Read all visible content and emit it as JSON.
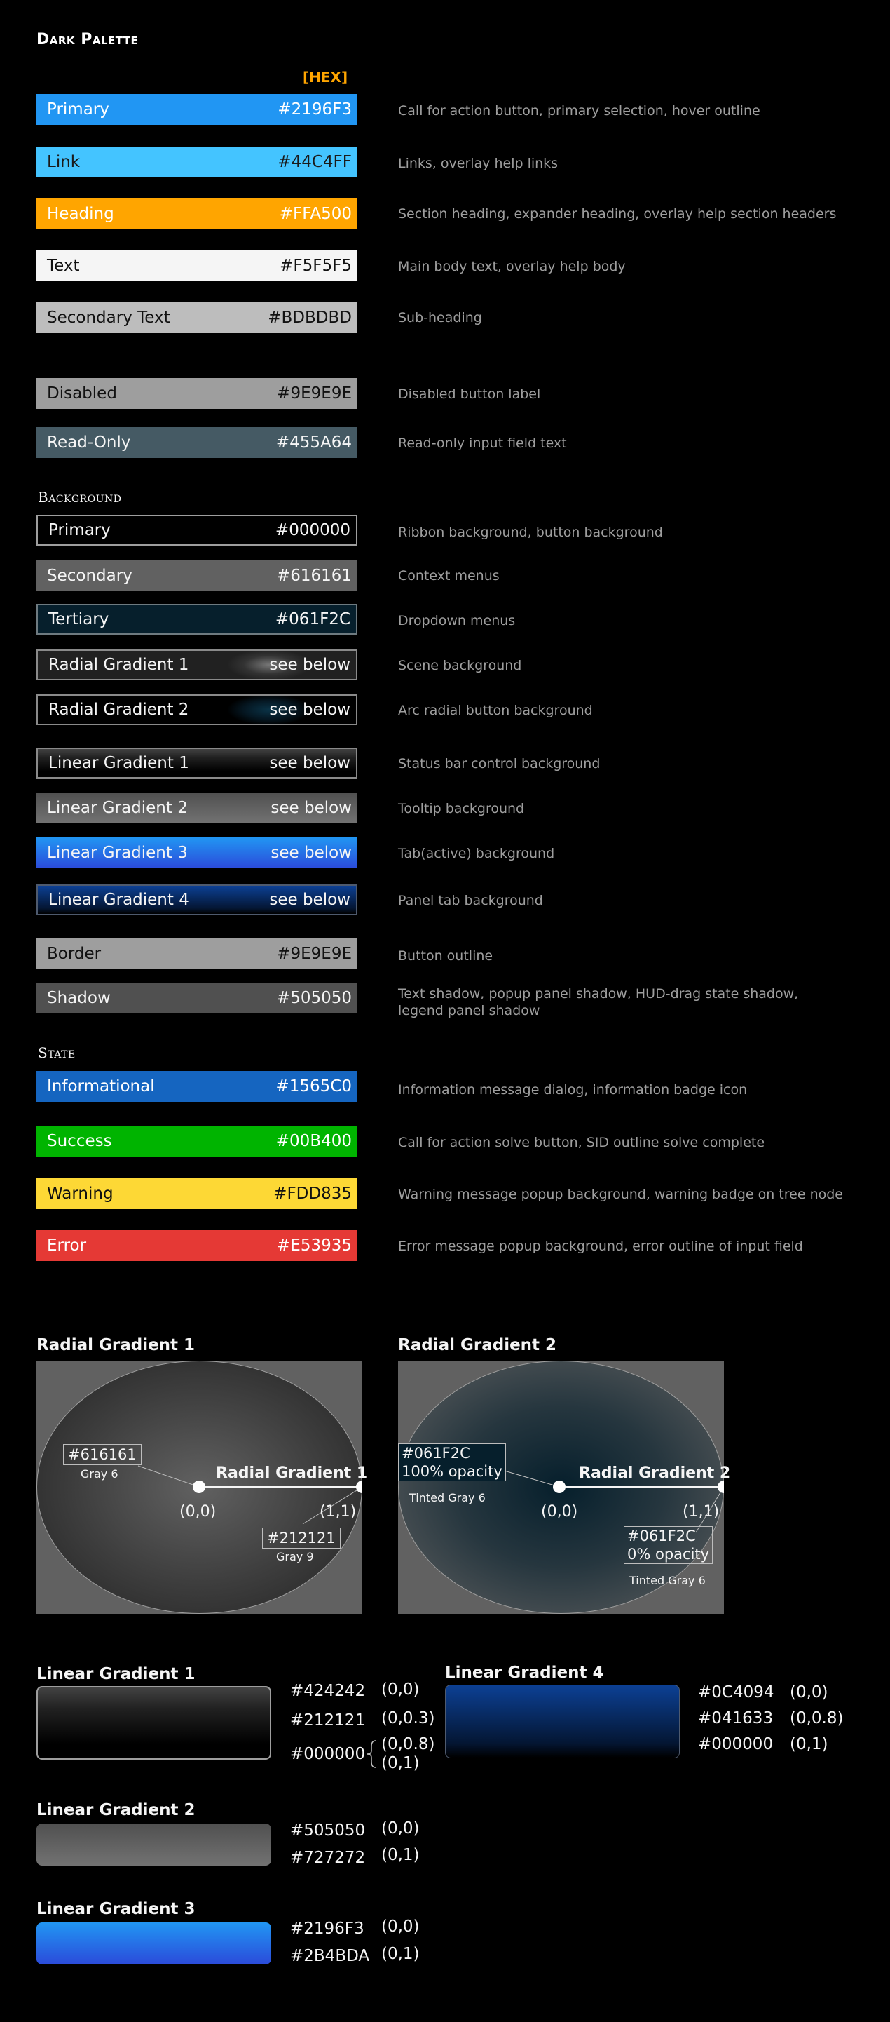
{
  "title": "Dark Palette",
  "hex_header": "[HEX]",
  "sections": {
    "background": "Background",
    "state": "State"
  },
  "text_rows": [
    {
      "name": "Primary",
      "hex": "#2196F3",
      "desc": "Call for action button, primary selection, hover outline",
      "bg": "#2196F3",
      "fg": "#FFFFFF"
    },
    {
      "name": "Link",
      "hex": "#44C4FF",
      "desc": "Links, overlay help links",
      "bg": "#44C4FF",
      "fg": "#1A1A1A"
    },
    {
      "name": "Heading",
      "hex": "#FFA500",
      "desc": "Section heading, expander heading, overlay help section headers",
      "bg": "#FFA500",
      "fg": "#FFFFFF"
    },
    {
      "name": "Text",
      "hex": "#F5F5F5",
      "desc": "Main body text, overlay help body",
      "bg": "#F5F5F5",
      "fg": "#111111"
    },
    {
      "name": "Secondary Text",
      "hex": "#BDBDBD",
      "desc": "Sub-heading",
      "bg": "#BDBDBD",
      "fg": "#111111"
    },
    {
      "name": "Disabled",
      "hex": "#9E9E9E",
      "desc": "Disabled button label",
      "bg": "#9E9E9E",
      "fg": "#111111"
    },
    {
      "name": "Read-Only",
      "hex": "#455A64",
      "desc": "Read-only input field text",
      "bg": "#455A64",
      "fg": "#F5F5F5"
    }
  ],
  "background_rows": [
    {
      "name": "Primary",
      "hex": "#000000",
      "desc": "Ribbon background, button background"
    },
    {
      "name": "Secondary",
      "hex": "#616161",
      "desc": "Context menus"
    },
    {
      "name": "Tertiary",
      "hex": "#061F2C",
      "desc": "Dropdown menus"
    },
    {
      "name": "Radial Gradient 1",
      "hex": "see below",
      "desc": "Scene background"
    },
    {
      "name": "Radial Gradient 2",
      "hex": "see below",
      "desc": "Arc radial button background"
    },
    {
      "name": "Linear Gradient 1",
      "hex": "see below",
      "desc": "Status bar control background"
    },
    {
      "name": "Linear Gradient 2",
      "hex": "see below",
      "desc": "Tooltip background"
    },
    {
      "name": "Linear Gradient 3",
      "hex": "see below",
      "desc": "Tab(active) background"
    },
    {
      "name": "Linear Gradient 4",
      "hex": "see below",
      "desc": "Panel tab background"
    },
    {
      "name": "Border",
      "hex": "#9E9E9E",
      "desc": "Button outline"
    },
    {
      "name": "Shadow",
      "hex": "#505050",
      "desc": "Text shadow, popup panel shadow, HUD-drag state shadow, legend panel shadow"
    }
  ],
  "state_rows": [
    {
      "name": "Informational",
      "hex": "#1565C0",
      "desc": "Information message dialog, information badge icon",
      "bg": "#1565C0"
    },
    {
      "name": "Success",
      "hex": "#00B400",
      "desc": "Call for action solve button, SID outline solve complete",
      "bg": "#00B400"
    },
    {
      "name": "Warning",
      "hex": "#FDD835",
      "desc": "Warning message popup background, warning badge on tree node",
      "bg": "#FDD835"
    },
    {
      "name": "Error",
      "hex": "#E53935",
      "desc": "Error message popup background, error outline of input field",
      "bg": "#E53935"
    }
  ],
  "radial1": {
    "title": "Radial Gradient 1",
    "label": "Radial Gradient 1",
    "center_coord": "(0,0)",
    "edge_coord": "(1,1)",
    "callout1_hex": "#616161",
    "callout1_sub": "Gray 6",
    "callout2_hex": "#212121",
    "callout2_sub": "Gray 9"
  },
  "radial2": {
    "title": "Radial Gradient 2",
    "label": "Radial Gradient 2",
    "center_coord": "(0,0)",
    "edge_coord": "(1,1)",
    "callout1_hex": "#061F2C",
    "callout1_opacity": "100% opacity",
    "callout1_sub": "Tinted Gray 6",
    "callout2_hex": "#061F2C",
    "callout2_opacity": "0% opacity",
    "callout2_sub": "Tinted Gray 6"
  },
  "linear1": {
    "title": "Linear Gradient 1",
    "stops": [
      {
        "hex": "#424242",
        "pos": "(0,0)"
      },
      {
        "hex": "#212121",
        "pos": "(0,0.3)"
      },
      {
        "hex": "#000000",
        "pos": "(0,0.8)",
        "pos2": "(0,1)"
      }
    ]
  },
  "linear2": {
    "title": "Linear Gradient 2",
    "stops": [
      {
        "hex": "#505050",
        "pos": "(0,0)"
      },
      {
        "hex": "#727272",
        "pos": "(0,1)"
      }
    ]
  },
  "linear3": {
    "title": "Linear Gradient 3",
    "stops": [
      {
        "hex": "#2196F3",
        "pos": "(0,0)"
      },
      {
        "hex": "#2B4BDA",
        "pos": "(0,1)"
      }
    ]
  },
  "linear4": {
    "title": "Linear Gradient 4",
    "stops": [
      {
        "hex": "#0C4094",
        "pos": "(0,0)"
      },
      {
        "hex": "#041633",
        "pos": "(0,0.8)"
      },
      {
        "hex": "#000000",
        "pos": "(0,1)"
      }
    ]
  }
}
